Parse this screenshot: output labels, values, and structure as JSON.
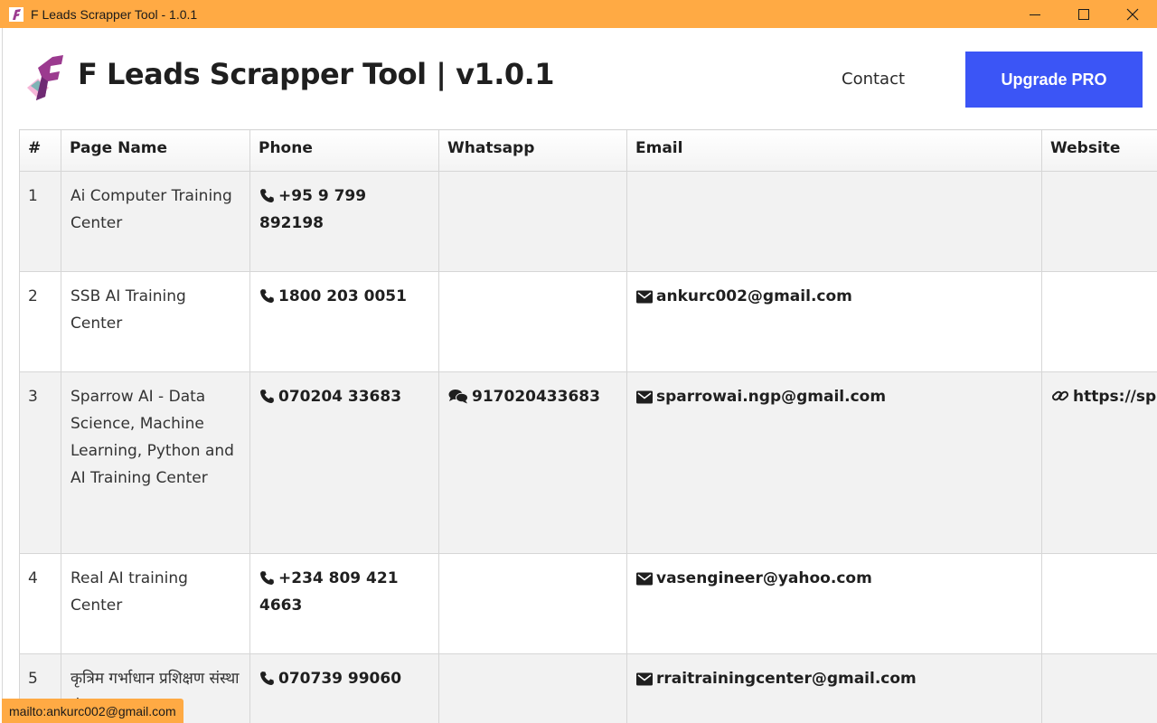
{
  "window": {
    "title": "F Leads Scrapper Tool - 1.0.1",
    "controls": [
      "minimize-icon",
      "maximize-icon",
      "close-icon"
    ]
  },
  "header": {
    "brand": "F Leads Scrapper Tool | v1.0.1",
    "contact_label": "Contact",
    "upgrade_label": "Upgrade PRO"
  },
  "colors": {
    "titlebar": "#ffaa44",
    "accent": "#3b55f6",
    "row_alt": "#f2f2f2"
  },
  "table": {
    "columns": [
      "#",
      "Page Name",
      "Phone",
      "Whatsapp",
      "Email",
      "Website"
    ],
    "rows": [
      {
        "index": "1",
        "page_name": "Ai Computer Training Center",
        "phone": "+95 9 799 892198",
        "whatsapp": "",
        "email": "",
        "website": ""
      },
      {
        "index": "2",
        "page_name": "SSB AI Training Center",
        "phone": "1800 203 0051",
        "whatsapp": "",
        "email": "ankurc002@gmail.com",
        "website": ""
      },
      {
        "index": "3",
        "page_name": "Sparrow AI - Data Science, Machine Learning, Python and AI Training Center",
        "phone": "070204 33683",
        "whatsapp": "917020433683",
        "email": "sparrowai.ngp@gmail.com",
        "website": "https://sp"
      },
      {
        "index": "4",
        "page_name": "Real AI training Center",
        "phone": "+234 809 421 4663",
        "whatsapp": "",
        "email": "vasengineer@yahoo.com",
        "website": ""
      },
      {
        "index": "5",
        "page_name": "कृत्रिम गर्भाधान प्रशिक्षण संस्था मंडल R.R. Ai",
        "phone": "070739 99060",
        "whatsapp": "",
        "email": "rraitrainingcenter@gmail.com",
        "website": ""
      }
    ]
  },
  "status_bar": {
    "text": "mailto:ankurc002@gmail.com"
  }
}
